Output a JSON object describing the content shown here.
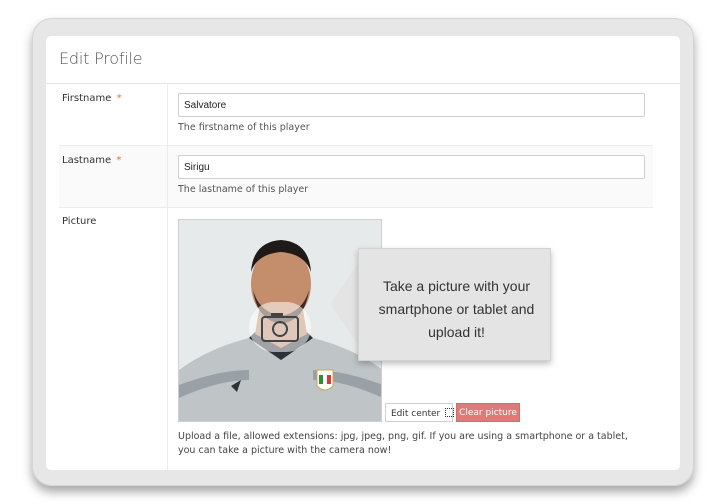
{
  "card": {
    "title": "Edit Profile"
  },
  "firstname": {
    "label": "Firstname",
    "required": "*",
    "value": "Salvatore",
    "help": "The firstname of this player"
  },
  "lastname": {
    "label": "Lastname",
    "required": "*",
    "value": "Sirigu",
    "help": "The lastname of this player"
  },
  "picture": {
    "label": "Picture",
    "callout": "Take a picture with your smartphone or tablet and upload it!",
    "edit_center_label": "Edit center",
    "clear_label": "Clear picture",
    "help": "Upload a file, allowed extensions: jpg, jpeg, png, gif. If you are using a smartphone or a tablet, you can take a picture with the camera now!",
    "camera_icon": "camera-icon",
    "kit_badge_text": "ITALIA"
  },
  "colors": {
    "accent_required": "#e0703f",
    "clear_button": "#e07a7a"
  }
}
